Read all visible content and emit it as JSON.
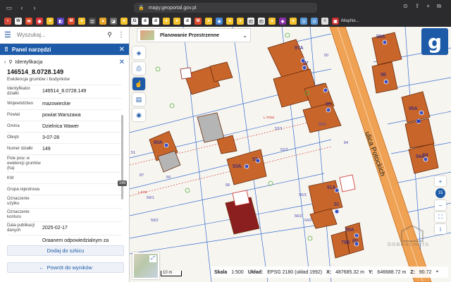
{
  "browser": {
    "url": "mapy.geoportal.gov.pl",
    "bookmark_last_label": "iMapNe..."
  },
  "search": {
    "placeholder": "Wyszukaj..."
  },
  "tool_panel": {
    "title": "Panel narzędzi"
  },
  "identification": {
    "title": "Identyfikacja",
    "parcel_id": "146514_8.0728.149",
    "subtitle": "Ewidencja gruntów i budynków",
    "rows": [
      {
        "key": "Identyfikator działki",
        "value": "146514_8.0728.149"
      },
      {
        "key": "Województwo",
        "value": "mazowieckie"
      },
      {
        "key": "Powiat",
        "value": "powiat Warszawa"
      },
      {
        "key": "Gmina",
        "value": "Dzielnica Wawer"
      },
      {
        "key": "Obręb",
        "value": "3-07-28"
      },
      {
        "key": "Numer działki",
        "value": "149"
      },
      {
        "key": "Pole pow. w ewidencji gruntów (ha)",
        "value": ""
      },
      {
        "key": "KW",
        "value": ""
      },
      {
        "key": "Grupa rejestrowa",
        "value": ""
      },
      {
        "key": "Oznaczenie użytku",
        "value": ""
      },
      {
        "key": "Oznaczenie konturu",
        "value": ""
      },
      {
        "key": "Data publikacji danych",
        "value": "2025-02-17"
      },
      {
        "key": "",
        "value": "Oraanem odpowiedzialnym za"
      }
    ],
    "scroll_tooltip": "149",
    "add_sketch_label": "Dodaj do szkicu",
    "back_label": "Powrót do wyników"
  },
  "layer_dropdown": {
    "label": "Planowanie Przestrzenne"
  },
  "map": {
    "street_label": "ulica Potockich",
    "building_labels": [
      "98A",
      "97A",
      "97",
      "98",
      "96",
      "95",
      "96A",
      "80A",
      "93A",
      "93",
      "94",
      "94A",
      "91A",
      "91",
      "89A",
      "79B",
      "89"
    ],
    "parcel_labels": [
      "51",
      "52/1",
      "52/2",
      "59",
      "58",
      "56/3",
      "56/2",
      "87",
      "59/1",
      "59/2",
      "64/2",
      "84",
      "50",
      "50/2"
    ],
    "red_labels": [
      "L.70/26",
      "L.67/6"
    ]
  },
  "zoom": {
    "level": "15"
  },
  "status": {
    "scale_label": "Skala",
    "scale_value": "1:500",
    "crs_label": "Układ:",
    "crs_value": "EPSG 2180 (układ 1992)",
    "x_label": "X:",
    "x_value": "487685.32 m",
    "y_label": "Y:",
    "y_value": "646688.72 m",
    "z_label": "Z:",
    "z_value": "90.72",
    "scalebar": "10 m"
  },
  "watermark": "DOBRACHATA",
  "colors": {
    "accent": "#1d5ba8",
    "building_orange": "#c8652a",
    "building_gray": "#b5b5b5",
    "building_dark": "#8b1f1f",
    "parcel_lines": "#3a6fd4",
    "street": "#f0a254"
  }
}
